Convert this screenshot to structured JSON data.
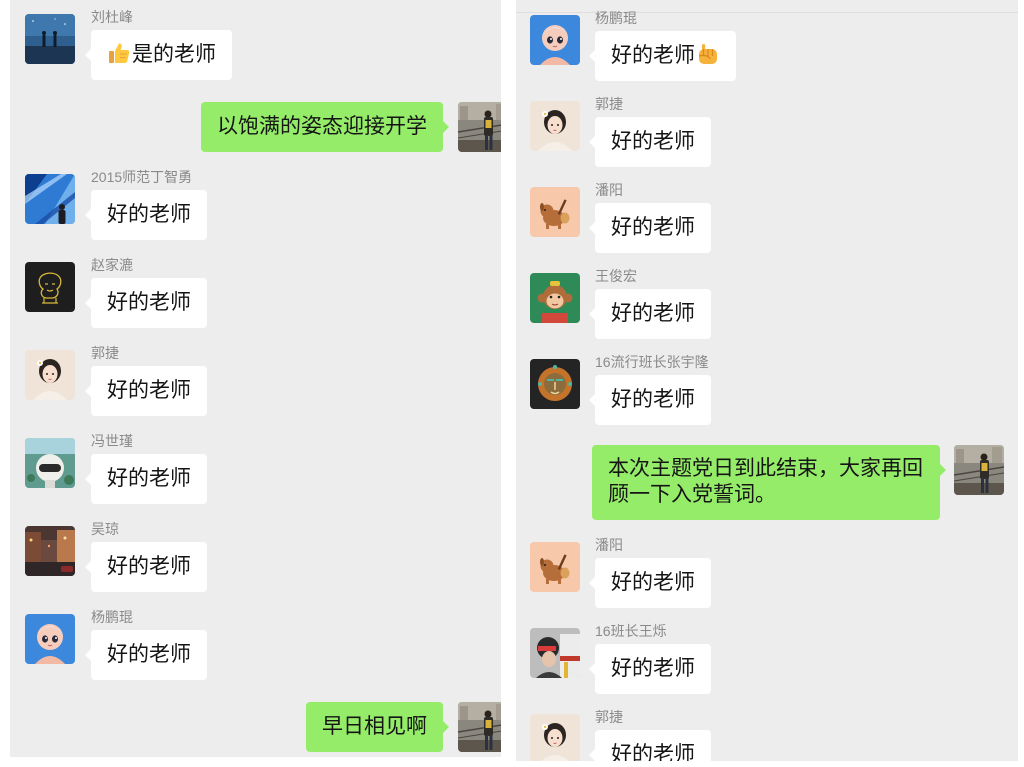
{
  "colors": {
    "chat_background": "#EDEDED",
    "received_bubble": "#FFFFFF",
    "sent_bubble": "#95EC69",
    "sender_name": "#8A8A8A"
  },
  "left_panel": {
    "messages": [
      {
        "outgoing": false,
        "sender": "刘杜峰",
        "text": "是的老师",
        "emoji_icon": "thumbs-up-icon"
      },
      {
        "outgoing": true,
        "text": "以饱满的姿态迎接开学"
      },
      {
        "outgoing": false,
        "sender": "2015师范丁智勇",
        "text": "好的老师"
      },
      {
        "outgoing": false,
        "sender": "赵家漉",
        "text": "好的老师"
      },
      {
        "outgoing": false,
        "sender": "郭捷",
        "text": "好的老师"
      },
      {
        "outgoing": false,
        "sender": "冯世瑾",
        "text": "好的老师"
      },
      {
        "outgoing": false,
        "sender": "吴琼",
        "text": "好的老师"
      },
      {
        "outgoing": false,
        "sender": "杨鹏琨",
        "text": "好的老师"
      },
      {
        "outgoing": true,
        "text": "早日相见啊"
      }
    ]
  },
  "right_panel": {
    "messages": [
      {
        "outgoing": false,
        "sender": "杨鹏琨",
        "text": "好的老师",
        "emoji_icon": "raised-fist-icon"
      },
      {
        "outgoing": false,
        "sender": "郭捷",
        "text": "好的老师"
      },
      {
        "outgoing": false,
        "sender": "潘阳",
        "text": "好的老师"
      },
      {
        "outgoing": false,
        "sender": "王俊宏",
        "text": "好的老师"
      },
      {
        "outgoing": false,
        "sender": "16流行班长张宇隆",
        "text": "好的老师"
      },
      {
        "outgoing": true,
        "text": "本次主题党日到此结束，大家再回顾一下入党誓词。"
      },
      {
        "outgoing": false,
        "sender": "潘阳",
        "text": "好的老师"
      },
      {
        "outgoing": false,
        "sender": "16班长王烁",
        "text": "好的老师"
      },
      {
        "outgoing": false,
        "sender": "郭捷",
        "text": "好的老师"
      }
    ]
  }
}
